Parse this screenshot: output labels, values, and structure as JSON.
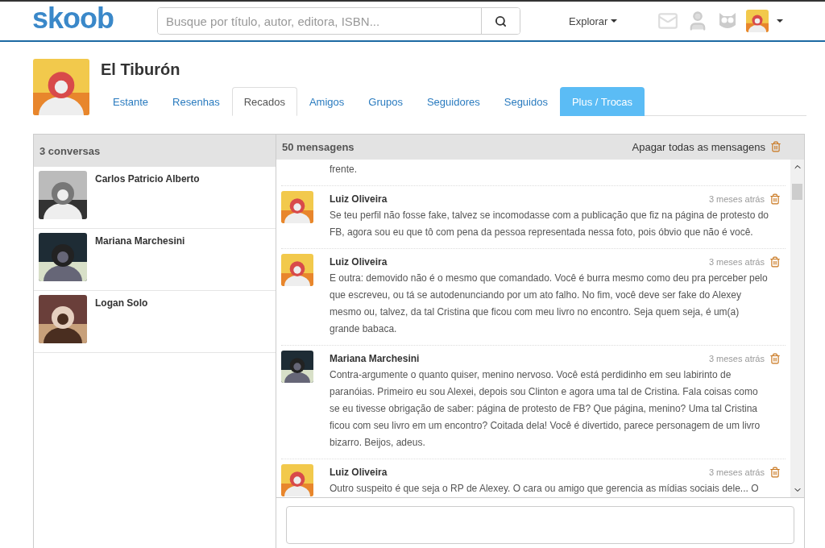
{
  "header": {
    "logo": "skoob",
    "search": {
      "placeholder": "Busque por título, autor, editora, ISBN..."
    },
    "explore": "Explorar"
  },
  "profile": {
    "name": "El Tiburón",
    "tabs": [
      {
        "label": "Estante",
        "selected": false,
        "kind": "plain"
      },
      {
        "label": "Resenhas",
        "selected": false,
        "kind": "plain"
      },
      {
        "label": "Recados",
        "selected": true,
        "kind": "plain"
      },
      {
        "label": "Amigos",
        "selected": false,
        "kind": "plain"
      },
      {
        "label": "Grupos",
        "selected": false,
        "kind": "plain"
      },
      {
        "label": "Seguidores",
        "selected": false,
        "kind": "plain"
      },
      {
        "label": "Seguidos",
        "selected": false,
        "kind": "plain"
      },
      {
        "label": "Plus / Trocas",
        "selected": false,
        "kind": "plus"
      }
    ]
  },
  "conversations": {
    "title": "3 conversas",
    "items": [
      {
        "name": "Carlos Patricio Alberto"
      },
      {
        "name": "Mariana Marchesini"
      },
      {
        "name": "Logan Solo"
      }
    ]
  },
  "messages": {
    "title": "50 mensagens",
    "delete_all": "Apagar todas as mensagens",
    "items": [
      {
        "text": "frente."
      },
      {
        "author": "Luiz Oliveira",
        "time": "3 meses atrás",
        "text": "Se teu perfil não fosse fake, talvez se incomodasse com a publicação que fiz na página de protesto do FB, agora sou eu que tô com pena da pessoa representada nessa foto, pois óbvio que não é você."
      },
      {
        "author": "Luiz Oliveira",
        "time": "3 meses atrás",
        "text": "E outra: demovido não é o mesmo que comandado. Você é burra mesmo como deu pra perceber pelo que escreveu, ou tá se autodenunciando por um ato falho. No fim, você deve ser fake do Alexey mesmo ou, talvez, da tal Cristina que ficou com meu livro no encontro. Seja quem seja, é um(a) grande babaca."
      },
      {
        "author": "Mariana Marchesini",
        "time": "3 meses atrás",
        "text": "Contra-argumente o quanto quiser, menino nervoso. Você está perdidinho em seu labirinto de paranóias. Primeiro eu sou Alexei, depois sou Clinton e agora uma tal de Cristina. Fala coisas como se eu tivesse obrigação de saber: página de protesto de FB? Que página, menino? Uma tal Cristina ficou com seu livro em um encontro? Coitada dela! Você é divertido, parece personagem de um livro bizarro. Beijos, adeus."
      },
      {
        "author": "Luiz Oliveira",
        "time": "3 meses atrás",
        "text": "Outro suspeito é que seja o RP de Alexey. O cara ou amigo que gerencia as mídias sociais dele... O"
      }
    ]
  }
}
